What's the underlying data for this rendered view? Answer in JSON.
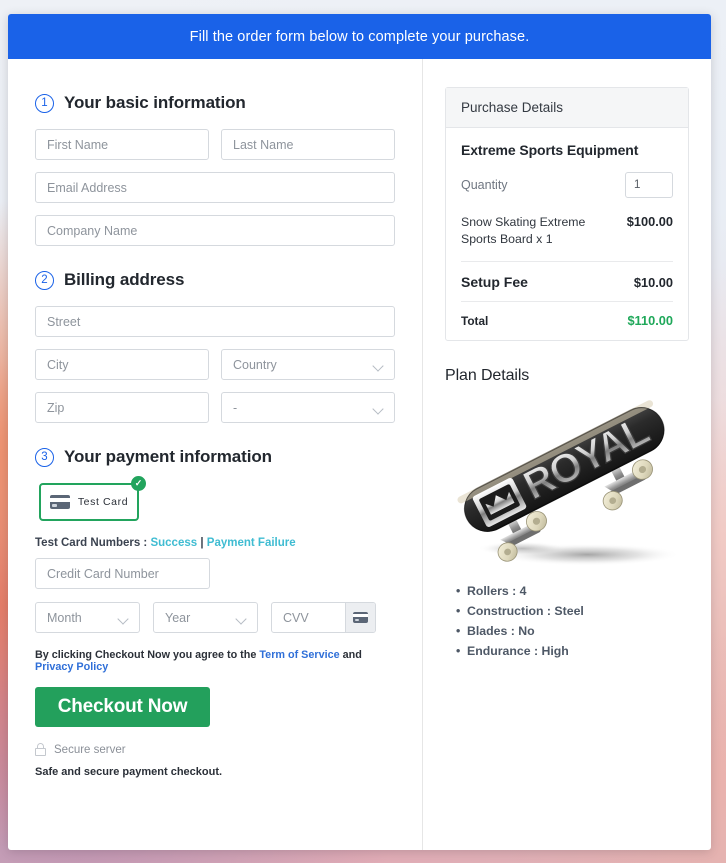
{
  "banner": {
    "text": "Fill the order form below to complete your purchase."
  },
  "sections": {
    "basic": {
      "number": "1",
      "title": "Your basic information",
      "fields": {
        "first_name": "First Name",
        "last_name": "Last Name",
        "email": "Email Address",
        "company": "Company Name"
      }
    },
    "billing": {
      "number": "2",
      "title": "Billing address",
      "fields": {
        "street": "Street",
        "city": "City",
        "country": "Country",
        "zip": "Zip",
        "state": "-"
      }
    },
    "payment": {
      "number": "3",
      "title": "Your payment information",
      "tile_label": "Test  Card",
      "tile_icon": "credit-card-icon",
      "tile_selected_icon": "check-circle-icon",
      "testcards_prefix": "Test Card Numbers :",
      "testcards_success": "Success",
      "testcards_separator": "|",
      "testcards_failure": "Payment Failure",
      "fields": {
        "credit_card": "Credit Card Number",
        "month": "Month",
        "year": "Year",
        "cvv": "CVV"
      },
      "cvv_icon": "credit-card-icon",
      "terms_prefix": "By clicking Checkout Now you agree to the",
      "terms_link1": "Term of Service",
      "terms_and": "and",
      "terms_link2": "Privacy Policy",
      "checkout_label": "Checkout Now",
      "secure_icon": "lock-icon",
      "secure_label": "Secure server",
      "safe_note": "Safe and secure payment checkout."
    }
  },
  "purchase": {
    "panel_title": "Purchase Details",
    "product_title": "Extreme Sports Equipment",
    "quantity_label": "Quantity",
    "quantity_value": "1",
    "line_item_name": "Snow Skating Extreme Sports Board x 1",
    "line_item_amount": "$100.00",
    "setup_fee_label": "Setup Fee",
    "setup_fee_amount": "$10.00",
    "total_label": "Total",
    "total_amount": "$110.00"
  },
  "plan": {
    "title": "Plan Details",
    "image_name": "skateboard-product-image",
    "image_brand_text": "ROYAL",
    "features": [
      "Rollers : 4",
      "Construction : Steel",
      "Blades : No",
      "Endurance : High"
    ]
  },
  "colors": {
    "banner_blue": "#1a62e8",
    "accent_blue": "#1a62e8",
    "success_green": "#23a05c",
    "total_green": "#1fa85a",
    "link_teal": "#3fbcd2",
    "link_blue": "#2f6fd8"
  }
}
